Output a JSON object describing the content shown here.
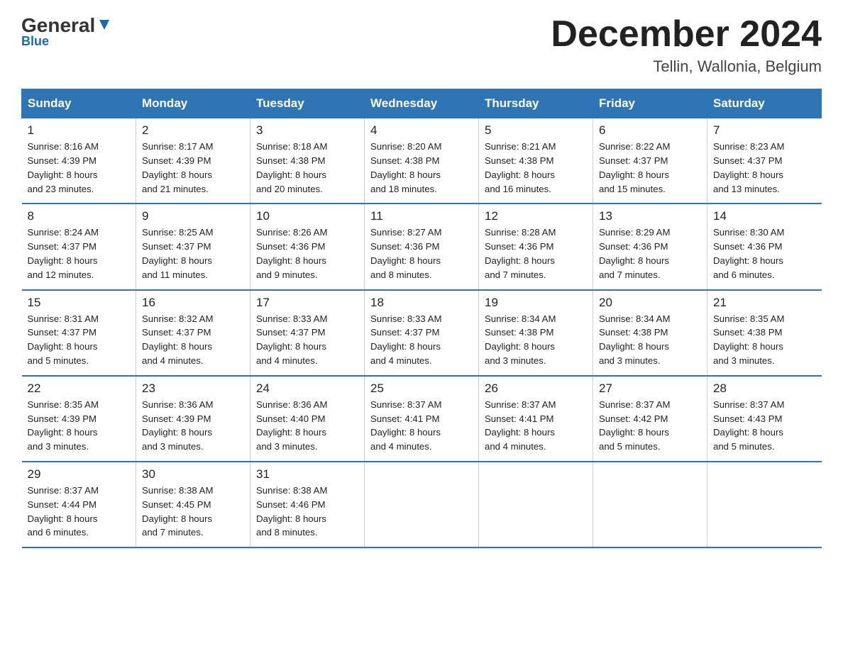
{
  "header": {
    "logo_name": "General",
    "logo_blue": "Blue",
    "month": "December 2024",
    "location": "Tellin, Wallonia, Belgium"
  },
  "days_of_week": [
    "Sunday",
    "Monday",
    "Tuesday",
    "Wednesday",
    "Thursday",
    "Friday",
    "Saturday"
  ],
  "weeks": [
    [
      {
        "day": "1",
        "sunrise": "8:16 AM",
        "sunset": "4:39 PM",
        "daylight": "8 hours and 23 minutes."
      },
      {
        "day": "2",
        "sunrise": "8:17 AM",
        "sunset": "4:39 PM",
        "daylight": "8 hours and 21 minutes."
      },
      {
        "day": "3",
        "sunrise": "8:18 AM",
        "sunset": "4:38 PM",
        "daylight": "8 hours and 20 minutes."
      },
      {
        "day": "4",
        "sunrise": "8:20 AM",
        "sunset": "4:38 PM",
        "daylight": "8 hours and 18 minutes."
      },
      {
        "day": "5",
        "sunrise": "8:21 AM",
        "sunset": "4:38 PM",
        "daylight": "8 hours and 16 minutes."
      },
      {
        "day": "6",
        "sunrise": "8:22 AM",
        "sunset": "4:37 PM",
        "daylight": "8 hours and 15 minutes."
      },
      {
        "day": "7",
        "sunrise": "8:23 AM",
        "sunset": "4:37 PM",
        "daylight": "8 hours and 13 minutes."
      }
    ],
    [
      {
        "day": "8",
        "sunrise": "8:24 AM",
        "sunset": "4:37 PM",
        "daylight": "8 hours and 12 minutes."
      },
      {
        "day": "9",
        "sunrise": "8:25 AM",
        "sunset": "4:37 PM",
        "daylight": "8 hours and 11 minutes."
      },
      {
        "day": "10",
        "sunrise": "8:26 AM",
        "sunset": "4:36 PM",
        "daylight": "8 hours and 9 minutes."
      },
      {
        "day": "11",
        "sunrise": "8:27 AM",
        "sunset": "4:36 PM",
        "daylight": "8 hours and 8 minutes."
      },
      {
        "day": "12",
        "sunrise": "8:28 AM",
        "sunset": "4:36 PM",
        "daylight": "8 hours and 7 minutes."
      },
      {
        "day": "13",
        "sunrise": "8:29 AM",
        "sunset": "4:36 PM",
        "daylight": "8 hours and 7 minutes."
      },
      {
        "day": "14",
        "sunrise": "8:30 AM",
        "sunset": "4:36 PM",
        "daylight": "8 hours and 6 minutes."
      }
    ],
    [
      {
        "day": "15",
        "sunrise": "8:31 AM",
        "sunset": "4:37 PM",
        "daylight": "8 hours and 5 minutes."
      },
      {
        "day": "16",
        "sunrise": "8:32 AM",
        "sunset": "4:37 PM",
        "daylight": "8 hours and 4 minutes."
      },
      {
        "day": "17",
        "sunrise": "8:33 AM",
        "sunset": "4:37 PM",
        "daylight": "8 hours and 4 minutes."
      },
      {
        "day": "18",
        "sunrise": "8:33 AM",
        "sunset": "4:37 PM",
        "daylight": "8 hours and 4 minutes."
      },
      {
        "day": "19",
        "sunrise": "8:34 AM",
        "sunset": "4:38 PM",
        "daylight": "8 hours and 3 minutes."
      },
      {
        "day": "20",
        "sunrise": "8:34 AM",
        "sunset": "4:38 PM",
        "daylight": "8 hours and 3 minutes."
      },
      {
        "day": "21",
        "sunrise": "8:35 AM",
        "sunset": "4:38 PM",
        "daylight": "8 hours and 3 minutes."
      }
    ],
    [
      {
        "day": "22",
        "sunrise": "8:35 AM",
        "sunset": "4:39 PM",
        "daylight": "8 hours and 3 minutes."
      },
      {
        "day": "23",
        "sunrise": "8:36 AM",
        "sunset": "4:39 PM",
        "daylight": "8 hours and 3 minutes."
      },
      {
        "day": "24",
        "sunrise": "8:36 AM",
        "sunset": "4:40 PM",
        "daylight": "8 hours and 3 minutes."
      },
      {
        "day": "25",
        "sunrise": "8:37 AM",
        "sunset": "4:41 PM",
        "daylight": "8 hours and 4 minutes."
      },
      {
        "day": "26",
        "sunrise": "8:37 AM",
        "sunset": "4:41 PM",
        "daylight": "8 hours and 4 minutes."
      },
      {
        "day": "27",
        "sunrise": "8:37 AM",
        "sunset": "4:42 PM",
        "daylight": "8 hours and 5 minutes."
      },
      {
        "day": "28",
        "sunrise": "8:37 AM",
        "sunset": "4:43 PM",
        "daylight": "8 hours and 5 minutes."
      }
    ],
    [
      {
        "day": "29",
        "sunrise": "8:37 AM",
        "sunset": "4:44 PM",
        "daylight": "8 hours and 6 minutes."
      },
      {
        "day": "30",
        "sunrise": "8:38 AM",
        "sunset": "4:45 PM",
        "daylight": "8 hours and 7 minutes."
      },
      {
        "day": "31",
        "sunrise": "8:38 AM",
        "sunset": "4:46 PM",
        "daylight": "8 hours and 8 minutes."
      },
      null,
      null,
      null,
      null
    ]
  ],
  "labels": {
    "sunrise": "Sunrise:",
    "sunset": "Sunset:",
    "daylight": "Daylight:"
  }
}
